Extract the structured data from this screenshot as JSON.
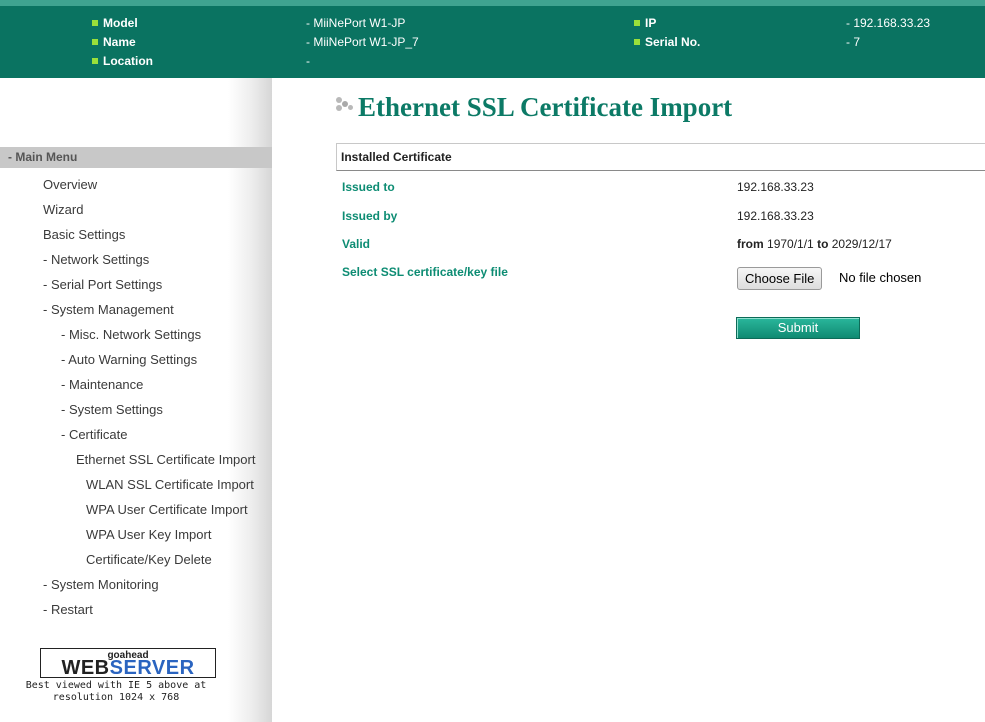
{
  "header": {
    "model_key": "Model",
    "model_value": "- MiiNePort W1-JP",
    "name_key": "Name",
    "name_value": "- MiiNePort W1-JP_7",
    "location_key": "Location",
    "location_value": "-",
    "ip_key": "IP",
    "ip_value": "- 192.168.33.23",
    "serial_key": "Serial No.",
    "serial_value": "- 7",
    "bullet_color": "#9adf3a",
    "bar_color": "#0a7361"
  },
  "sidebar": {
    "menu_header": "- Main Menu",
    "items": [
      "Overview",
      "Wizard",
      "Basic Settings",
      "- Network Settings",
      "- Serial Port Settings",
      "- System Management",
      "- Misc. Network Settings",
      "- Auto Warning Settings",
      "- Maintenance",
      "- System Settings",
      "- Certificate",
      "Ethernet SSL Certificate Import",
      "WLAN SSL Certificate Import",
      "WPA User Certificate Import",
      "WPA User Key Import",
      "Certificate/Key Delete",
      "- System Monitoring",
      "- Restart"
    ],
    "logo_small": "goahead",
    "logo_part1": "WEB",
    "logo_part2": "SERVER",
    "best_line1": "Best viewed with IE 5 above at",
    "best_line2": "resolution 1024 x 768"
  },
  "main": {
    "title": "Ethernet SSL Certificate Import",
    "section_label": "Installed Certificate",
    "issued_to_label": "Issued to",
    "issued_to_value": "192.168.33.23",
    "issued_by_label": "Issued by",
    "issued_by_value": "192.168.33.23",
    "valid_label": "Valid",
    "valid_from_word": "from",
    "valid_from_date": "1970/1/1",
    "valid_to_word": "to",
    "valid_to_date": "2029/12/17",
    "select_label": "Select SSL certificate/key file",
    "choose_file_button": "Choose File",
    "file_status": "No file chosen",
    "submit_button": "Submit",
    "accent_color": "#0d8c73"
  }
}
